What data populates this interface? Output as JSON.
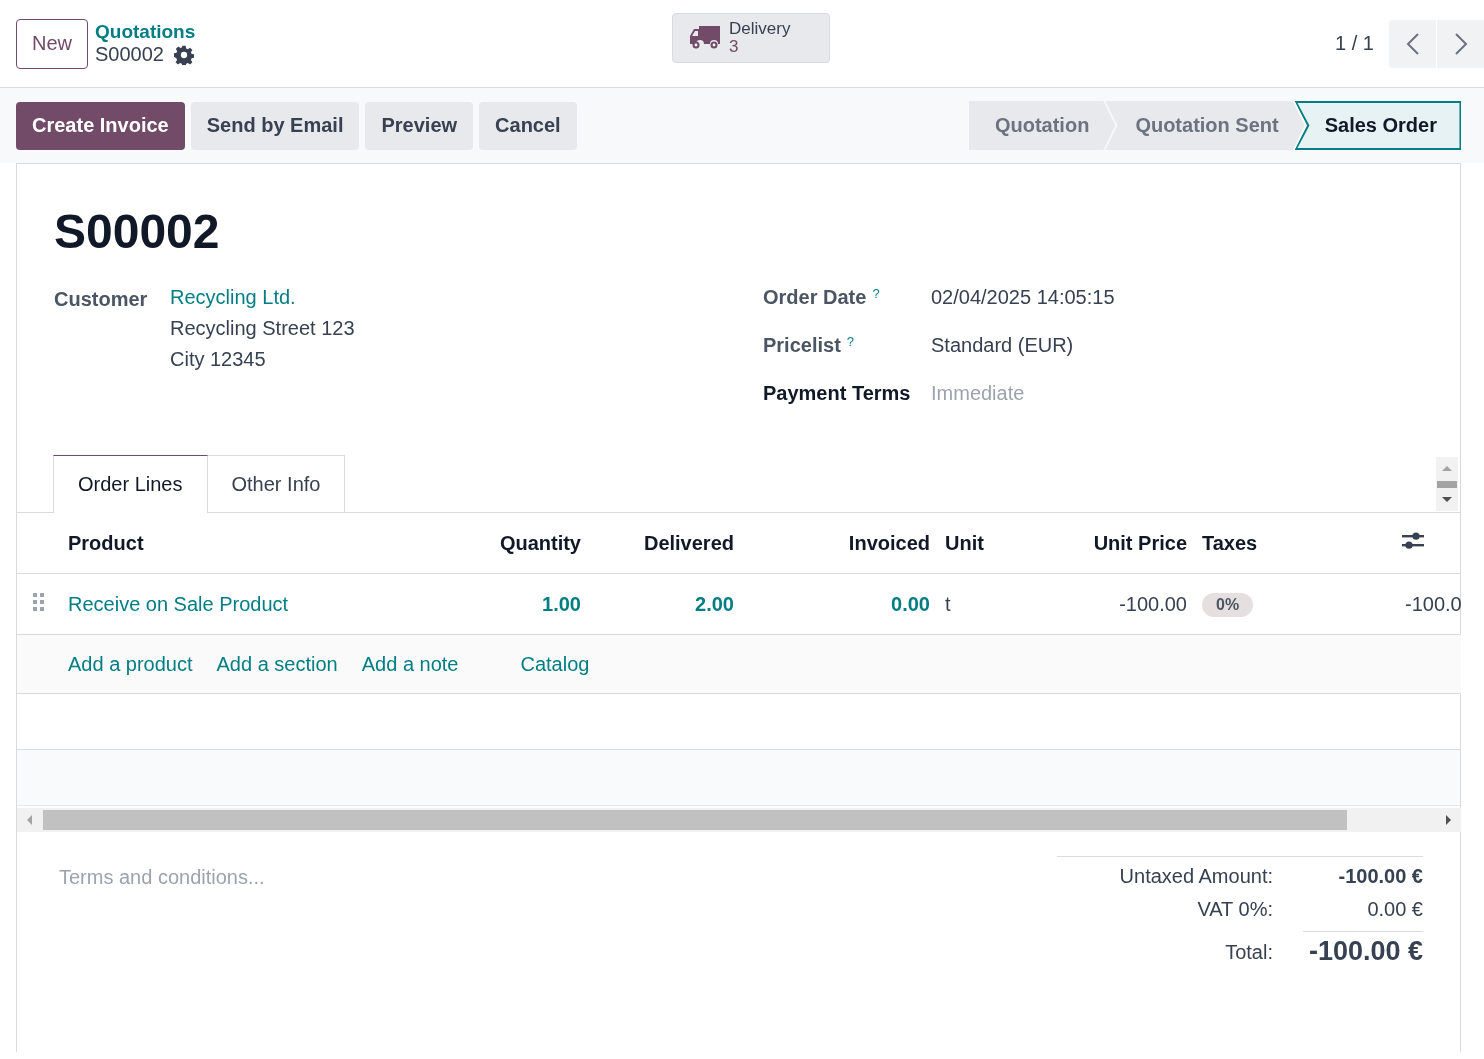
{
  "new_button": "New",
  "breadcrumb": {
    "parent": "Quotations",
    "current": "S00002"
  },
  "smart_button": {
    "label": "Delivery",
    "count": "3"
  },
  "pager": {
    "value": "1 / 1"
  },
  "actions": [
    {
      "label": "Create Invoice",
      "primary": true
    },
    {
      "label": "Send by Email",
      "primary": false
    },
    {
      "label": "Preview",
      "primary": false
    },
    {
      "label": "Cancel",
      "primary": false
    }
  ],
  "stages": [
    {
      "label": "Quotation",
      "selected": false
    },
    {
      "label": "Quotation Sent",
      "selected": false
    },
    {
      "label": "Sales Order",
      "selected": true
    }
  ],
  "title": "S00002",
  "customer": {
    "label": "Customer",
    "name": "Recycling Ltd.",
    "address": [
      "Recycling Street 123",
      "City 12345"
    ]
  },
  "fields": [
    {
      "label": "Order Date",
      "help": "?",
      "value": "02/04/2025 14:05:15"
    },
    {
      "label": "Pricelist",
      "help": "?",
      "value": "Standard (EUR)"
    },
    {
      "label": "Payment Terms",
      "placeholder": "Immediate"
    }
  ],
  "tabs": [
    {
      "label": "Order Lines",
      "selected": true
    },
    {
      "label": "Other Info",
      "selected": false
    }
  ],
  "table": {
    "columns": [
      "Product",
      "Quantity",
      "Delivered",
      "Invoiced",
      "Unit",
      "Unit Price",
      "Taxes"
    ],
    "rows": [
      {
        "product": "Receive on Sale Product",
        "quantity": "1.00",
        "delivered": "2.00",
        "invoiced": "0.00",
        "unit": "t",
        "unit_price": "-100.00",
        "taxes": [
          "0%"
        ],
        "column_8": "-100.0"
      }
    ]
  },
  "add_links": [
    "Add a product",
    "Add a section",
    "Add a note",
    "Catalog"
  ],
  "terms": {
    "placeholder": "Terms and conditions..."
  },
  "totals": [
    {
      "label": "Untaxed Amount:",
      "value": "-100.00 €",
      "kind": "subtotal"
    },
    {
      "label": "VAT 0%:",
      "value": "0.00 €",
      "kind": "tax"
    },
    {
      "label": "Total:",
      "value": "-100.00 €",
      "kind": "total"
    }
  ]
}
